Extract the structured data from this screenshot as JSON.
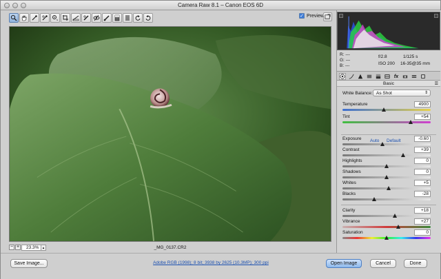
{
  "window": {
    "title": "Camera Raw 8.1  –  Canon EOS 6D"
  },
  "toolbar": {
    "tools": [
      "zoom-tool",
      "hand-tool",
      "white-balance-tool",
      "color-sampler-tool",
      "targeted-adjustment-tool",
      "crop-tool",
      "straighten-tool",
      "spot-removal-tool",
      "red-eye-tool",
      "adjustment-brush-tool",
      "graduated-filter-tool",
      "radial-filter-tool",
      "open-preferences",
      "rotate-ccw",
      "rotate-cw"
    ],
    "preview_label": "Preview",
    "preview_checked": true
  },
  "status": {
    "zoom": "23.3%",
    "filename": "_MG_0137.CR2"
  },
  "rgb": {
    "r_label": "R:",
    "g_label": "G:",
    "b_label": "B:",
    "r": "---",
    "g": "---",
    "b": "---"
  },
  "exif": {
    "aperture": "f/2.8",
    "shutter": "1/125 s",
    "iso": "ISO 200",
    "lens": "16-35@35 mm"
  },
  "panel": {
    "title": "Basic",
    "white_balance_label": "White Balance:",
    "white_balance_value": "As Shot",
    "auto_label": "Auto",
    "default_label": "Default",
    "controls": [
      {
        "label": "Temperature",
        "value": "4900",
        "pos": 0.47
      },
      {
        "label": "Tint",
        "value": "+54",
        "pos": 0.77
      },
      {
        "label": "Exposure",
        "value": "-0.60",
        "pos": 0.45
      },
      {
        "label": "Contrast",
        "value": "+39",
        "pos": 0.69
      },
      {
        "label": "Highlights",
        "value": "0",
        "pos": 0.5
      },
      {
        "label": "Shadows",
        "value": "0",
        "pos": 0.5
      },
      {
        "label": "Whites",
        "value": "+5",
        "pos": 0.52
      },
      {
        "label": "Blacks",
        "value": "-28",
        "pos": 0.36
      },
      {
        "label": "Clarity",
        "value": "+18",
        "pos": 0.59
      },
      {
        "label": "Vibrance",
        "value": "+27",
        "pos": 0.63
      },
      {
        "label": "Saturation",
        "value": "0",
        "pos": 0.5
      }
    ]
  },
  "bottom": {
    "save_label": "Save Image...",
    "workflow": "Adobe RGB (1998); 8 bit; 3938 by 2625 (10.3MP); 300 ppi",
    "open_label": "Open Image",
    "cancel_label": "Cancel",
    "done_label": "Done"
  },
  "colors": {
    "accent": "#3d7bd6",
    "link": "#1a4fb0"
  }
}
